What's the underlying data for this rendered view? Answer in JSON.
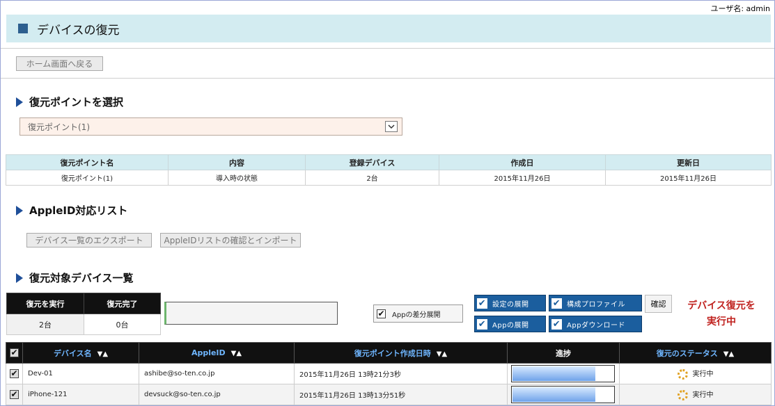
{
  "header": {
    "user_label": "ユーザ名: admin",
    "page_title": "デバイスの復元"
  },
  "nav": {
    "back_home": "ホーム画面へ戻る"
  },
  "restore_point": {
    "section_title": "復元ポイントを選択",
    "selected": "復元ポイント(1)",
    "table": {
      "headers": [
        "復元ポイント名",
        "内容",
        "登録デバイス",
        "作成日",
        "更新日"
      ],
      "row": [
        "復元ポイント(1)",
        "導入時の状態",
        "2台",
        "2015年11月26日",
        "2015年11月26日"
      ]
    }
  },
  "appleid": {
    "section_title": "AppleID対応リスト",
    "export_label": "デバイス一覧のエクスポート",
    "import_label": "AppleIDリストの確認とインポート"
  },
  "device_list": {
    "section_title": "復元対象デバイス一覧",
    "stats": {
      "running_header": "復元を実行",
      "done_header": "復元完了",
      "running_count": "2台",
      "done_count": "0台"
    },
    "options": {
      "diff_label": "Appの差分展開",
      "settings_label": "設定の展開",
      "profile_label": "構成プロファイル",
      "app_deploy_label": "Appの展開",
      "app_download_label": "Appダウンロード",
      "confirm_label": "確認"
    },
    "status_message_line1": "デバイス復元を",
    "status_message_line2": "実行中",
    "columns": {
      "device_name": "デバイス名",
      "apple_id": "AppleID",
      "created": "復元ポイント作成日時",
      "progress": "進捗",
      "status": "復元のステータス"
    },
    "rows": [
      {
        "name": "Dev-01",
        "apple_id": "ashibe@so-ten.co.jp",
        "created": "2015年11月26日 13時21分3秒",
        "progress": 0.82,
        "status": "実行中"
      },
      {
        "name": "iPhone-121",
        "apple_id": "devsuck@so-ten.co.jp",
        "created": "2015年11月26日 13時13分51秒",
        "progress": 0.82,
        "status": "実行中"
      }
    ]
  }
}
